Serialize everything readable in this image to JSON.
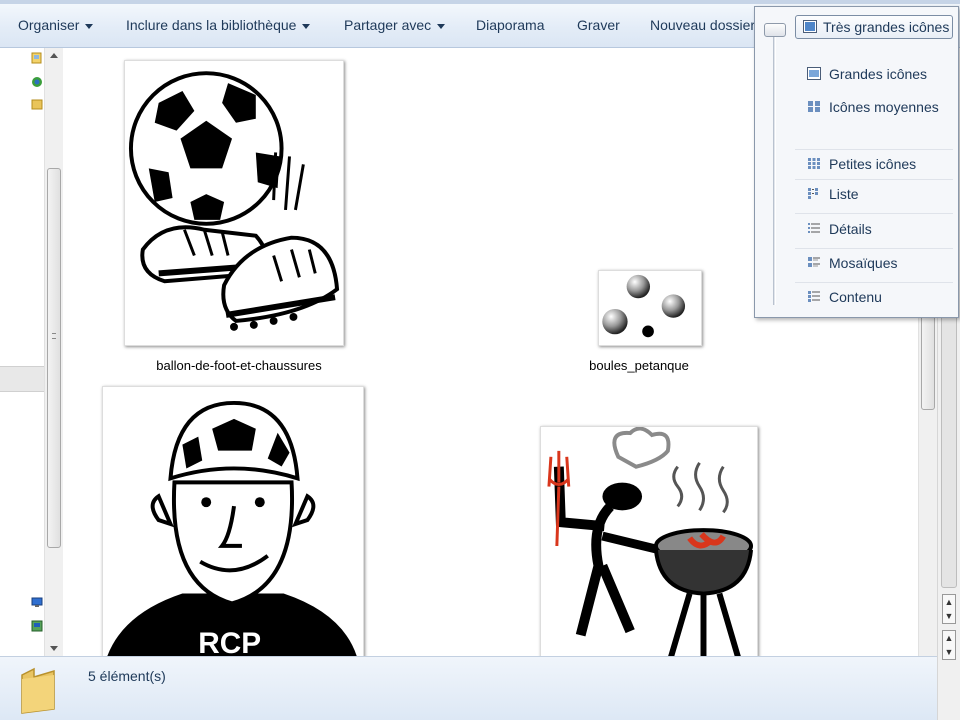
{
  "toolbar": {
    "items": [
      {
        "label": "Organiser",
        "has_dropdown": true
      },
      {
        "label": "Inclure dans la bibliothèque",
        "has_dropdown": true
      },
      {
        "label": "Partager avec",
        "has_dropdown": true
      },
      {
        "label": "Diaporama",
        "has_dropdown": false
      },
      {
        "label": "Graver",
        "has_dropdown": false
      },
      {
        "label": "Nouveau dossier",
        "has_dropdown": false
      }
    ]
  },
  "view_menu": {
    "selected_index": 0,
    "items": [
      {
        "label": "Très grandes icônes",
        "icon": "extra-large-icons-icon"
      },
      {
        "label": "Grandes icônes",
        "icon": "large-icons-icon"
      },
      {
        "label": "Icônes moyennes",
        "icon": "medium-icons-icon"
      },
      {
        "label": "Petites icônes",
        "icon": "small-icons-icon"
      },
      {
        "label": "Liste",
        "icon": "list-icon"
      },
      {
        "label": "Détails",
        "icon": "details-icon"
      },
      {
        "label": "Mosaïques",
        "icon": "tiles-icon"
      },
      {
        "label": "Contenu",
        "icon": "content-icon"
      }
    ]
  },
  "files": [
    {
      "name": "ballon-de-foot-et-chaussures",
      "icon": "soccer-ball-shoes-image"
    },
    {
      "name": "boules_petanque",
      "icon": "petanque-balls-image"
    },
    {
      "name": "",
      "icon": "soccer-head-man-image"
    },
    {
      "name": "",
      "icon": "barbecue-chef-image"
    }
  ],
  "status_bar": {
    "count_text": "5 élément(s)",
    "icon": "folder-icon"
  },
  "colors": {
    "toolbar_text": "#1e3959",
    "toolbar_bg": "#e3ecf7",
    "menu_bg": "#f5f7fa"
  }
}
